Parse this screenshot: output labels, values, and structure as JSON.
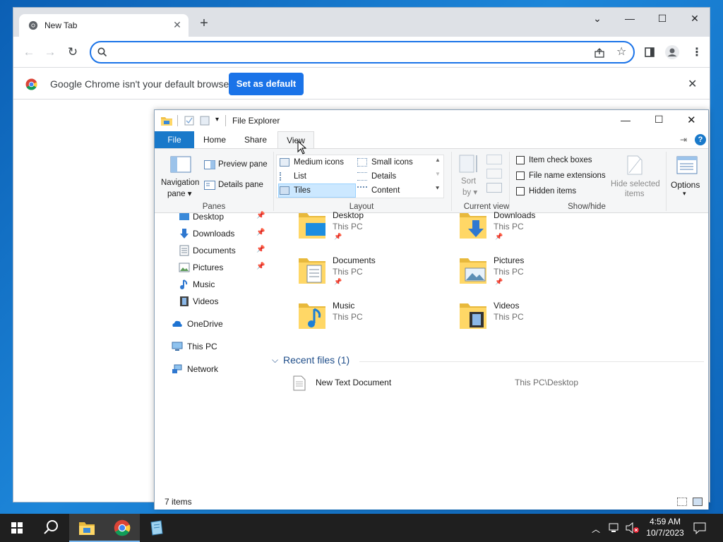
{
  "chrome": {
    "tab_title": "New Tab",
    "tab_close": "✕",
    "new_tab": "+",
    "omnibox_value": "",
    "infobar_message": "Google Chrome isn't your default browser",
    "set_default_label": "Set as default",
    "brand_color": "#1a73e8"
  },
  "explorer": {
    "title": "File Explorer",
    "ribbon_tabs": [
      "File",
      "Home",
      "Share",
      "View"
    ],
    "panes": {
      "navigation_pane_line1": "Navigation",
      "navigation_pane_line2": "pane",
      "preview_pane": "Preview pane",
      "details_pane": "Details pane",
      "group_label": "Panes"
    },
    "layout": {
      "items": [
        "Medium icons",
        "Small icons",
        "List",
        "Details",
        "Tiles",
        "Content"
      ],
      "selected": "Tiles",
      "group_label": "Layout"
    },
    "current_view": {
      "sort_line1": "Sort",
      "sort_line2": "by",
      "group_label": "Current view"
    },
    "show_hide": {
      "item_check_boxes": "Item check boxes",
      "file_name_extensions": "File name extensions",
      "hidden_items": "Hidden items",
      "hide_selected_line1": "Hide selected",
      "hide_selected_line2": "items",
      "group_label": "Show/hide",
      "item_check_boxes_checked": false,
      "file_name_extensions_checked": false,
      "hidden_items_checked": false
    },
    "options_label": "Options",
    "nav_items": [
      {
        "label": "Desktop",
        "pinned": true,
        "icon": "desktop-icon"
      },
      {
        "label": "Downloads",
        "pinned": true,
        "icon": "downloads-icon"
      },
      {
        "label": "Documents",
        "pinned": true,
        "icon": "documents-icon"
      },
      {
        "label": "Pictures",
        "pinned": true,
        "icon": "pictures-icon"
      },
      {
        "label": "Music",
        "pinned": false,
        "icon": "music-icon"
      },
      {
        "label": "Videos",
        "pinned": false,
        "icon": "videos-icon"
      },
      {
        "label": "OneDrive",
        "pinned": false,
        "icon": "onedrive-icon"
      },
      {
        "label": "This PC",
        "pinned": false,
        "icon": "this-pc-icon"
      },
      {
        "label": "Network",
        "pinned": false,
        "icon": "network-icon"
      }
    ],
    "folders": [
      {
        "name": "Desktop",
        "sub": "This PC",
        "pinned": true
      },
      {
        "name": "Downloads",
        "sub": "This PC",
        "pinned": true
      },
      {
        "name": "Documents",
        "sub": "This PC",
        "pinned": true
      },
      {
        "name": "Pictures",
        "sub": "This PC",
        "pinned": true
      },
      {
        "name": "Music",
        "sub": "This PC",
        "pinned": false
      },
      {
        "name": "Videos",
        "sub": "This PC",
        "pinned": false
      }
    ],
    "recent_header": "Recent files (1)",
    "recent_files": [
      {
        "name": "New Text Document",
        "path": "This PC\\Desktop"
      }
    ],
    "status_text": "7 items"
  },
  "taskbar": {
    "time": "4:59 AM",
    "date": "10/7/2023"
  }
}
